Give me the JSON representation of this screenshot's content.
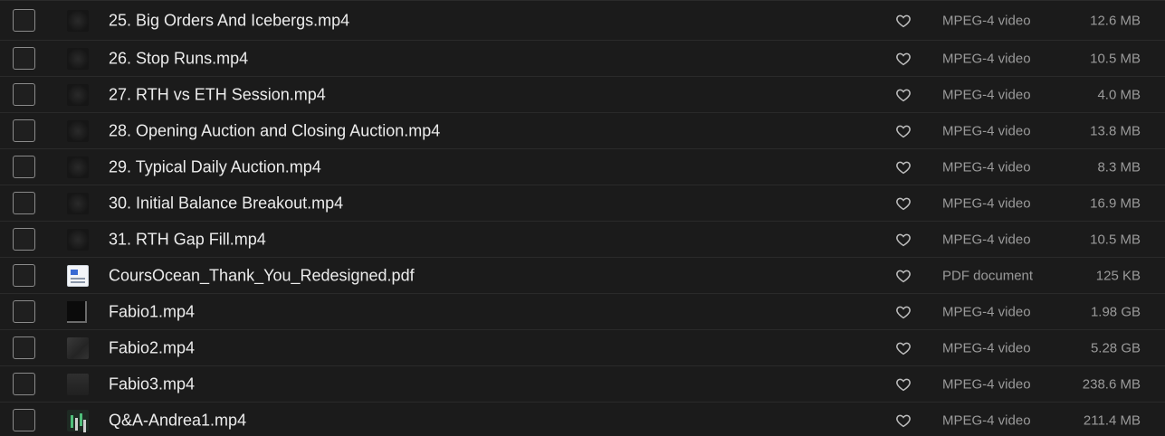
{
  "files": [
    {
      "name": "25. Big Orders And Icebergs.mp4",
      "type": "MPEG-4 video",
      "size": "12.6 MB",
      "thumb": "video-dark"
    },
    {
      "name": "26. Stop Runs.mp4",
      "type": "MPEG-4 video",
      "size": "10.5 MB",
      "thumb": "video-dark"
    },
    {
      "name": "27. RTH vs ETH Session.mp4",
      "type": "MPEG-4 video",
      "size": "4.0 MB",
      "thumb": "video-dark"
    },
    {
      "name": "28. Opening Auction and Closing Auction.mp4",
      "type": "MPEG-4 video",
      "size": "13.8 MB",
      "thumb": "video-dark"
    },
    {
      "name": "29. Typical Daily Auction.mp4",
      "type": "MPEG-4 video",
      "size": "8.3 MB",
      "thumb": "video-dark"
    },
    {
      "name": "30. Initial Balance Breakout.mp4",
      "type": "MPEG-4 video",
      "size": "16.9 MB",
      "thumb": "video-dark"
    },
    {
      "name": "31. RTH Gap Fill.mp4",
      "type": "MPEG-4 video",
      "size": "10.5 MB",
      "thumb": "video-dark"
    },
    {
      "name": "CoursOcean_Thank_You_Redesigned.pdf",
      "type": "PDF document",
      "size": "125 KB",
      "thumb": "pdf"
    },
    {
      "name": "Fabio1.mp4",
      "type": "MPEG-4 video",
      "size": "1.98 GB",
      "thumb": "fabio1"
    },
    {
      "name": "Fabio2.mp4",
      "type": "MPEG-4 video",
      "size": "5.28 GB",
      "thumb": "fabio2"
    },
    {
      "name": "Fabio3.mp4",
      "type": "MPEG-4 video",
      "size": "238.6 MB",
      "thumb": "fabio3"
    },
    {
      "name": "Q&A-Andrea1.mp4",
      "type": "MPEG-4 video",
      "size": "211.4 MB",
      "thumb": "qa"
    }
  ],
  "icons": {
    "favorite": "heart-outline-icon",
    "select": "checkbox"
  },
  "colors": {
    "background": "#1b1b1b",
    "row_divider": "#2a2a2a",
    "name_text": "#ececec",
    "meta_text": "#9a9a9a"
  }
}
